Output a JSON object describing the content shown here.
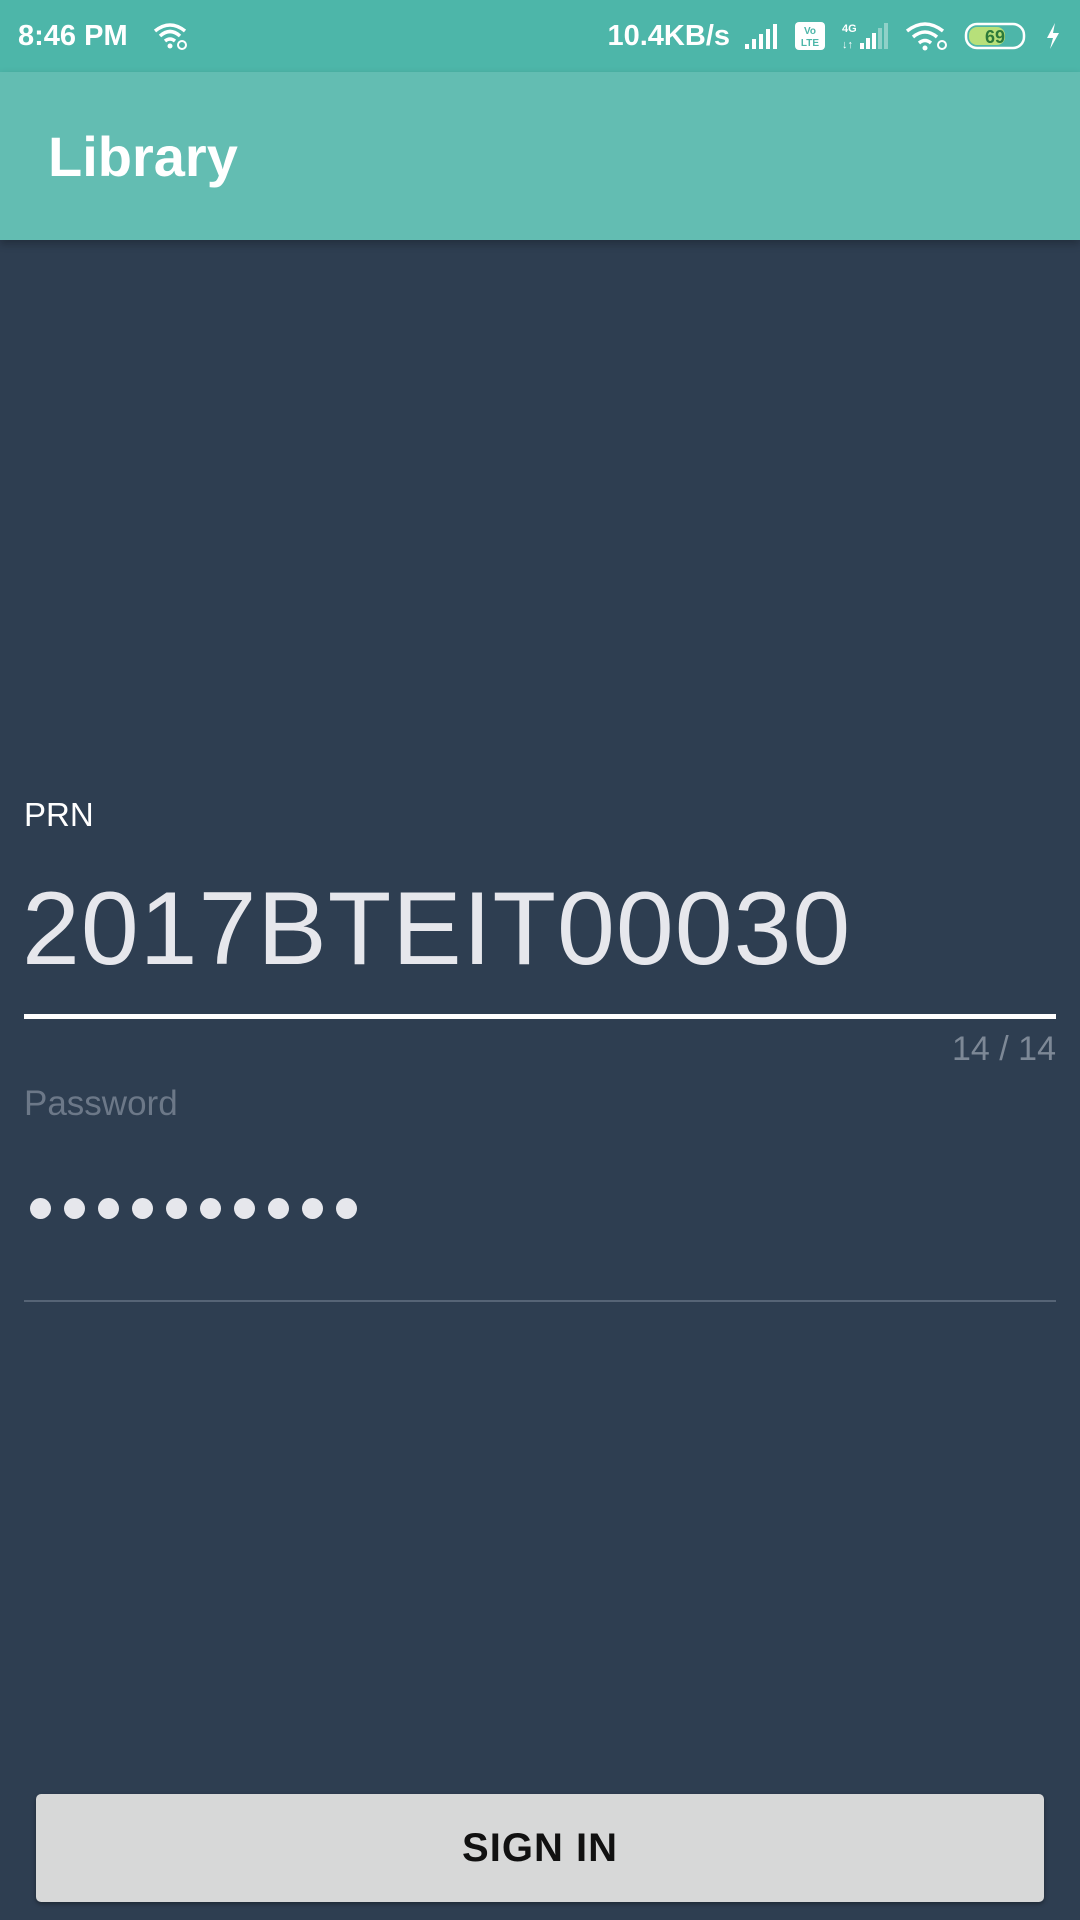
{
  "status_bar": {
    "time": "8:46 PM",
    "network_speed": "10.4KB/s",
    "volte_label": "Vo LTE",
    "network_type": "4G",
    "battery_level": "69",
    "icons": [
      "wifi-link-icon",
      "signal-icon",
      "volte-icon",
      "signal-4g-icon",
      "wifi-icon",
      "battery-icon",
      "charging-icon"
    ]
  },
  "app_bar": {
    "title": "Library"
  },
  "form": {
    "prn_label": "PRN",
    "prn_value": "2017BTEIT00030",
    "prn_counter": "14 / 14",
    "password_label": "Password",
    "password_length": 10
  },
  "actions": {
    "sign_in_label": "SIGN IN"
  },
  "colors": {
    "status_bar": "#4db6a9",
    "app_bar": "#63bdb2",
    "background": "#2e3e51",
    "button": "#d7d8d8"
  }
}
